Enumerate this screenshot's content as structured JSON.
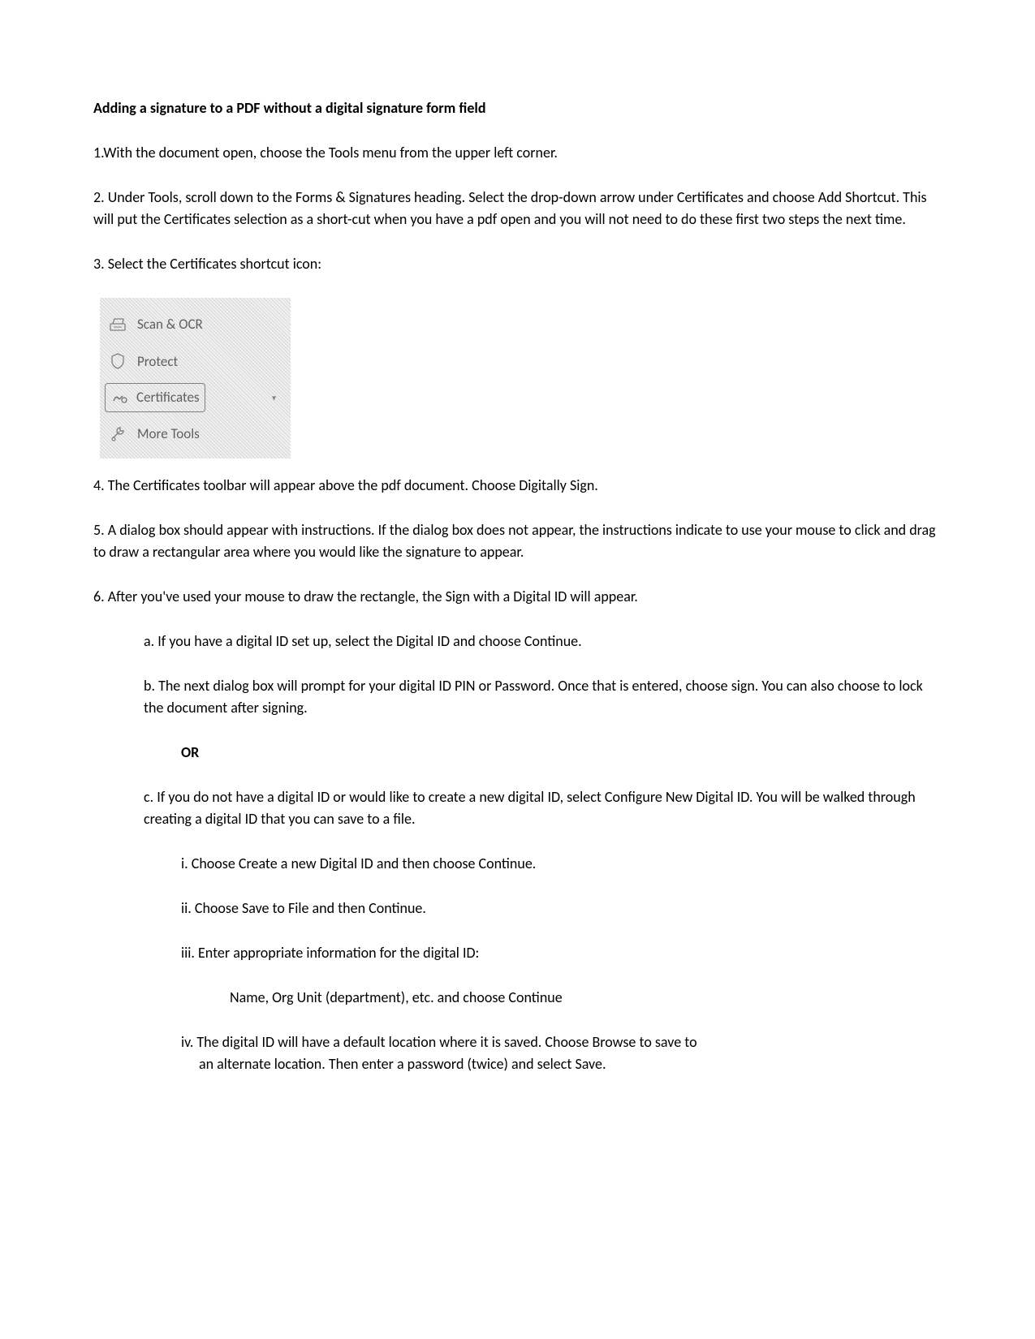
{
  "title": "Adding a signature to a PDF without a digital signature form field",
  "step1": "1.With the document open, choose the Tools menu from the upper left corner.",
  "step2": "2. Under Tools, scroll down to the Forms & Signatures heading. Select the drop-down arrow under Certificates and choose Add Shortcut. This will put the Certificates selection as a short-cut when you have a pdf open and you will not need to do these first two steps the next time.",
  "step3": "3. Select the Certificates shortcut icon:",
  "tools": {
    "scan": "Scan & OCR",
    "protect": "Protect",
    "certificates": "Certificates",
    "more": "More Tools"
  },
  "step4": "4. The Certificates toolbar will appear above the pdf document. Choose Digitally Sign.",
  "step5": "5. A dialog box should appear with instructions. If the dialog box does not appear, the instructions indicate to use your mouse to click and drag to draw a rectangular area where you would like the signature to appear.",
  "step6": "6. After you've used your mouse to draw the rectangle, the Sign with a Digital ID will appear.",
  "step6a": "a. If you have a digital ID set up, select the Digital ID and choose Continue.",
  "step6b": "b. The next dialog box will prompt for your digital ID PIN or Password. Once that is entered, choose sign. You can also choose to lock the document after signing.",
  "or": "OR",
  "step6c": "c. If you do not have a digital ID or would like to create a new digital ID, select Configure New Digital ID. You will be walked through creating a digital ID that you can save to a file.",
  "step6ci": "i. Choose Create a new Digital ID and then choose Continue.",
  "step6cii": "ii. Choose Save to File and then Continue.",
  "step6ciii": "iii. Enter appropriate information for the digital ID:",
  "step6ciii_detail": "Name, Org Unit (department), etc. and choose Continue",
  "step6civ_l1": "iv. The digital ID will have a default location where it is saved. Choose Browse to save to",
  "step6civ_l2": "an alternate location. Then enter a password (twice) and select Save."
}
